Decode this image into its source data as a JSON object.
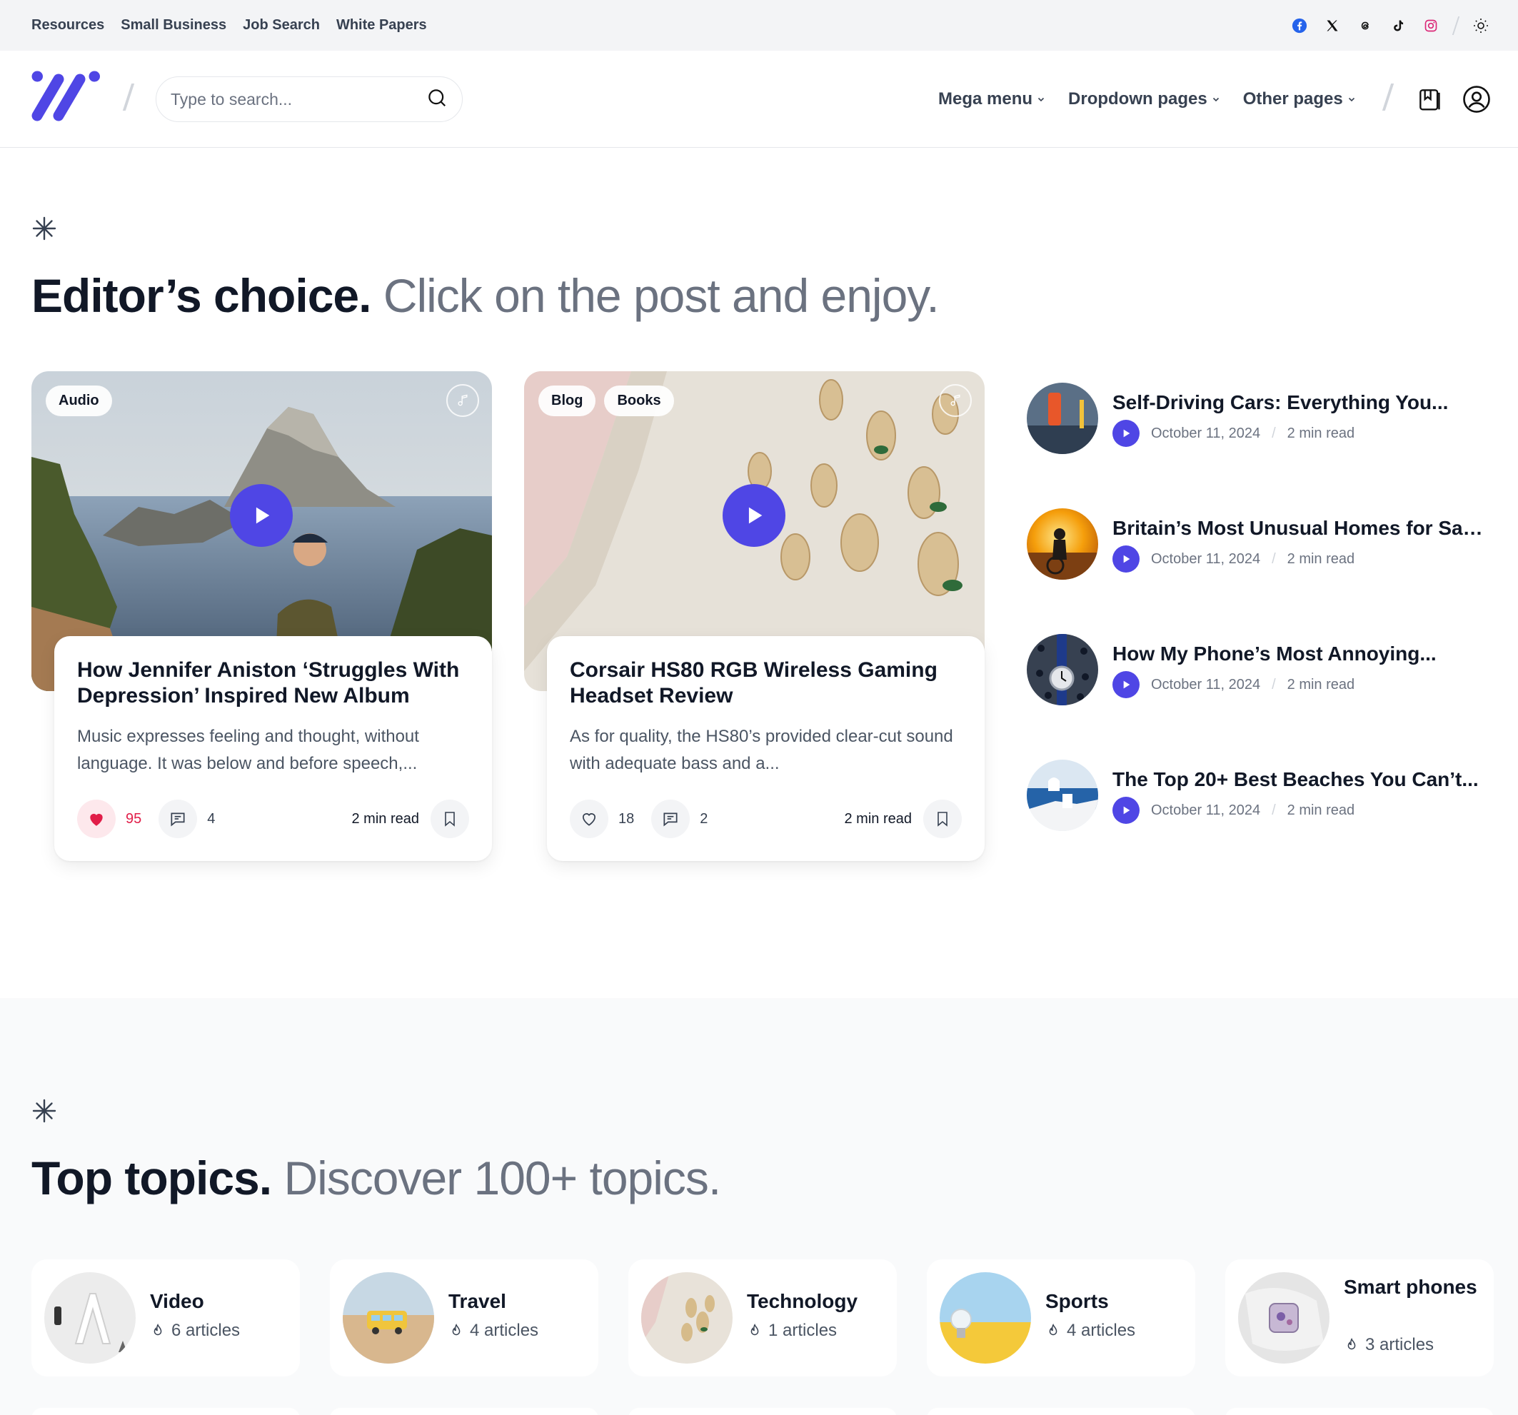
{
  "topbar": {
    "links": [
      "Resources",
      "Small Business",
      "Job Search",
      "White Papers"
    ],
    "socials": [
      "facebook-icon",
      "x-icon",
      "threads-icon",
      "tiktok-icon",
      "instagram-icon"
    ]
  },
  "header": {
    "search_placeholder": "Type to search...",
    "nav": [
      "Mega menu",
      "Dropdown pages",
      "Other pages"
    ]
  },
  "editors": {
    "title": "Editor’s choice.",
    "subtitle": "Click on the post and enjoy."
  },
  "cards": [
    {
      "badges": [
        "Audio"
      ],
      "title": "How Jennifer Aniston ‘Struggles With Depression’ Inspired New Album",
      "excerpt": "Music expresses feeling and thought, without language. It was below and before speech,...",
      "likes": "95",
      "comments": "4",
      "read": "2 min read"
    },
    {
      "badges": [
        "Blog",
        "Books"
      ],
      "title": "Corsair HS80 RGB Wireless Gaming Headset Review",
      "excerpt": "As for quality, the HS80’s provided clear-cut sound with adequate bass and a...",
      "likes": "18",
      "comments": "2",
      "read": "2 min read"
    }
  ],
  "side_posts": [
    {
      "title": "Self-Driving Cars: Everything You...",
      "date": "October 11, 2024",
      "read": "2 min read"
    },
    {
      "title": "Britain’s Most Unusual Homes for Sal...",
      "date": "October 11, 2024",
      "read": "2 min read"
    },
    {
      "title": "How My Phone’s Most Annoying...",
      "date": "October 11, 2024",
      "read": "2 min read"
    },
    {
      "title": "The Top 20+ Best Beaches You Can’t...",
      "date": "October 11, 2024",
      "read": "2 min read"
    }
  ],
  "topics_section": {
    "title": "Top topics.",
    "subtitle": "Discover 100+ topics."
  },
  "topics": [
    {
      "name": "Video",
      "count": "6 articles"
    },
    {
      "name": "Travel",
      "count": "4 articles"
    },
    {
      "name": "Technology",
      "count": "1 articles"
    },
    {
      "name": "Sports",
      "count": "4 articles"
    },
    {
      "name": "Smart phones",
      "count": "3 articles"
    }
  ],
  "colors": {
    "accent": "#4f46e5",
    "like": "#e11d48",
    "muted": "#6b7280"
  }
}
